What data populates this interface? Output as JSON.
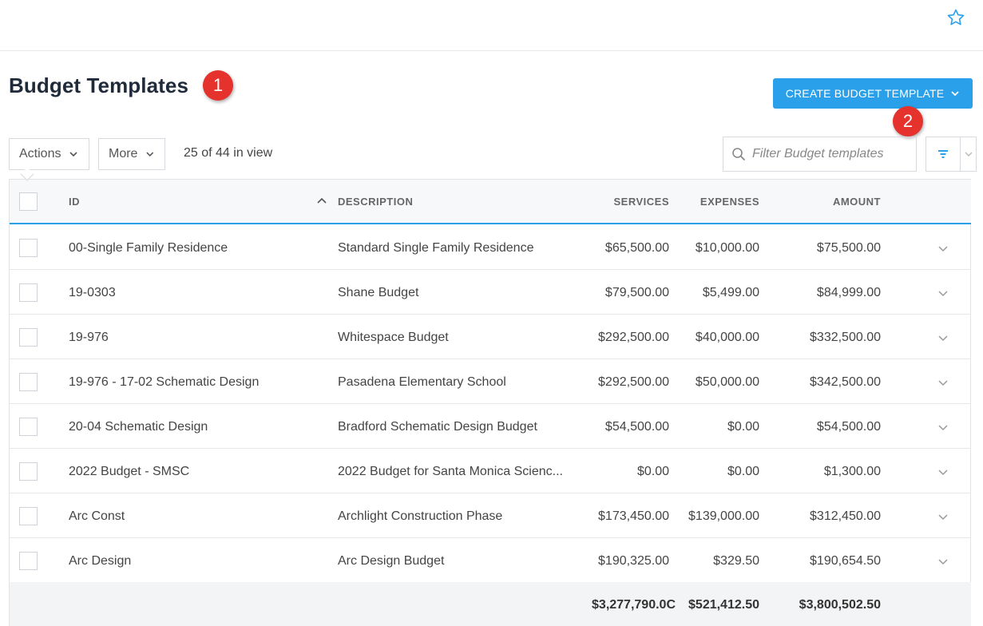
{
  "header": {
    "title": "Budget Templates",
    "star_icon": "star-icon"
  },
  "markers": [
    "1",
    "2"
  ],
  "toolbar": {
    "create_button": "CREATE BUDGET TEMPLATE",
    "actions_label": "Actions",
    "more_label": "More",
    "in_view": "25 of 44 in view",
    "filter_placeholder": "Filter Budget templates"
  },
  "table": {
    "columns": {
      "id": "ID",
      "description": "DESCRIPTION",
      "services": "SERVICES",
      "expenses": "EXPENSES",
      "amount": "AMOUNT"
    },
    "sort": {
      "column": "id",
      "direction": "ascending"
    },
    "rows": [
      {
        "id": "00-Single Family Residence",
        "description": "Standard Single Family Residence",
        "services": "$65,500.00",
        "expenses": "$10,000.00",
        "amount": "$75,500.00"
      },
      {
        "id": "19-0303",
        "description": "Shane Budget",
        "services": "$79,500.00",
        "expenses": "$5,499.00",
        "amount": "$84,999.00"
      },
      {
        "id": "19-976",
        "description": "Whitespace Budget",
        "services": "$292,500.00",
        "expenses": "$40,000.00",
        "amount": "$332,500.00"
      },
      {
        "id": "19-976 - 17-02 Schematic Design",
        "description": "Pasadena Elementary School",
        "services": "$292,500.00",
        "expenses": "$50,000.00",
        "amount": "$342,500.00"
      },
      {
        "id": "20-04 Schematic Design",
        "description": "Bradford Schematic Design Budget",
        "services": "$54,500.00",
        "expenses": "$0.00",
        "amount": "$54,500.00"
      },
      {
        "id": "2022 Budget - SMSC",
        "description": "2022 Budget for Santa Monica Scienc...",
        "services": "$0.00",
        "expenses": "$0.00",
        "amount": "$1,300.00"
      },
      {
        "id": "Arc Const",
        "description": "Archlight Construction Phase",
        "services": "$173,450.00",
        "expenses": "$139,000.00",
        "amount": "$312,450.00"
      },
      {
        "id": "Arc Design",
        "description": "Arc Design Budget",
        "services": "$190,325.00",
        "expenses": "$329.50",
        "amount": "$190,654.50"
      }
    ],
    "totals": {
      "services": "$3,277,790.0C",
      "expenses": "$521,412.50",
      "amount": "$3,800,502.50"
    }
  },
  "colors": {
    "accent": "#2aa0ea",
    "marker": "#e5322d",
    "title": "#1f2a3a"
  }
}
